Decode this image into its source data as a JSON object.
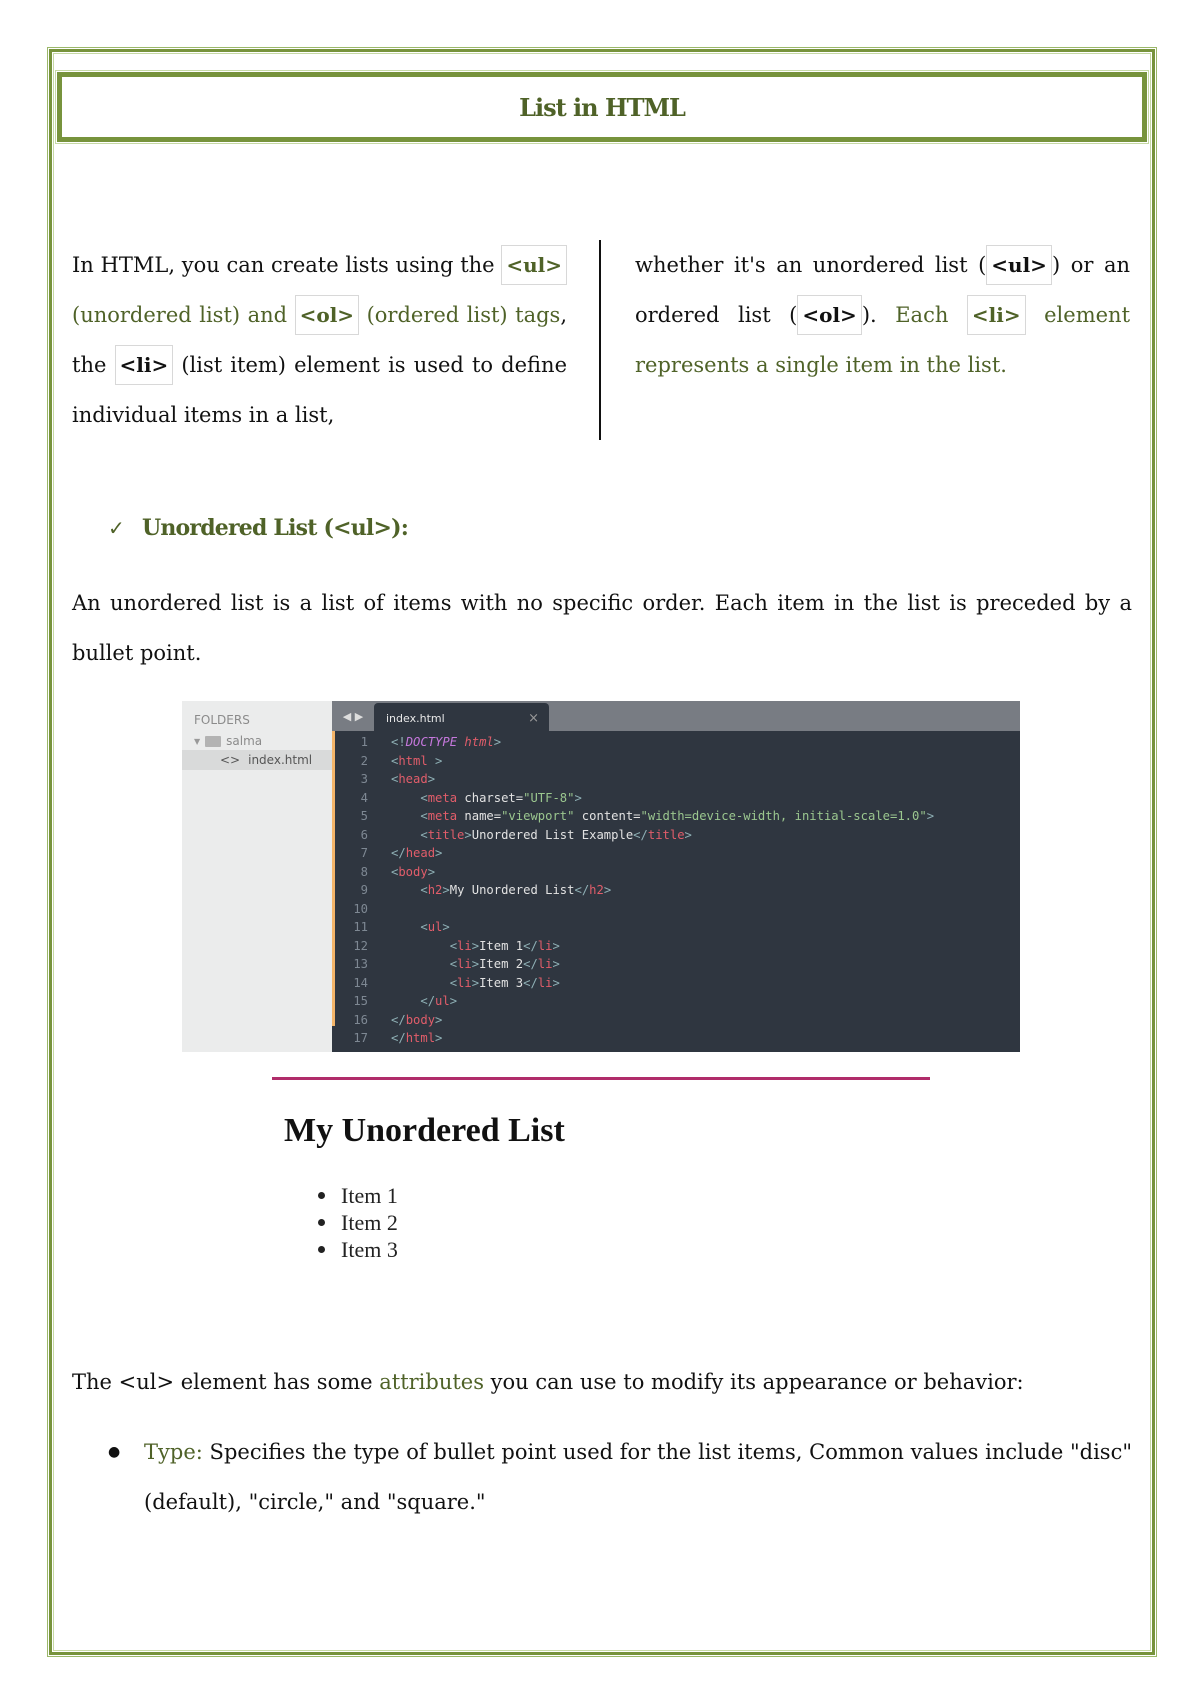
{
  "title": "List in HTML",
  "intro": {
    "left": {
      "t1": "In HTML, you can create lists using the ",
      "tag_ul": "<ul>",
      "t2": " (unordered list) and ",
      "tag_ol": "<ol>",
      "t3": " (ordered list) tags",
      "t4": ", the ",
      "tag_li": "<li>",
      "t5": " (list item) element is used to define individual items in a list,"
    },
    "right": {
      "t1": "whether it's an unordered list (",
      "tag_ul": "<ul>",
      "t2": ") or an ordered list (",
      "tag_ol": "<ol>",
      "t3": "). ",
      "t4": "Each ",
      "tag_li": "<li>",
      "t5": " element represents a single item in the list."
    }
  },
  "section": {
    "check_icon": "✓",
    "heading": "Unordered List (<ul>):",
    "description": "An unordered list is a list of items with no specific order. Each item in the list is preceded by a bullet point."
  },
  "editor": {
    "sidebar_title": "FOLDERS",
    "folder_name": "salma",
    "file_name": "index.html",
    "tab_name": "index.html",
    "tab_close": "×",
    "nav_arrows": "◀ ▶",
    "lines": [
      {
        "n": "1"
      },
      {
        "n": "2"
      },
      {
        "n": "3"
      },
      {
        "n": "4"
      },
      {
        "n": "5"
      },
      {
        "n": "6"
      },
      {
        "n": "7"
      },
      {
        "n": "8"
      },
      {
        "n": "9"
      },
      {
        "n": "10"
      },
      {
        "n": "11"
      },
      {
        "n": "12"
      },
      {
        "n": "13"
      },
      {
        "n": "14"
      },
      {
        "n": "15"
      },
      {
        "n": "16"
      },
      {
        "n": "17"
      }
    ],
    "code": {
      "l1_a": "<!",
      "l1_b": "DOCTYPE",
      "l1_c": " html",
      "l1_d": ">",
      "l2_tag": "html",
      "l3_tag": "head",
      "l4_tag": "meta",
      "l4_attr": " charset",
      "l4_val": "\"UTF-8\"",
      "l5_tag": "meta",
      "l5_attr1": " name",
      "l5_val1": "\"viewport\"",
      "l5_attr2": " content",
      "l5_val2": "\"width=device-width, initial-scale=1.0\"",
      "l6_tag": "title",
      "l6_text": "Unordered List Example",
      "l7_tag": "head",
      "l8_tag": "body",
      "l9_tag": "h2",
      "l9_text": "My Unordered List",
      "l11_tag": "ul",
      "li_tag": "li",
      "l12_text": "Item 1",
      "l13_text": "Item 2",
      "l14_text": "Item 3",
      "l15_tag": "ul",
      "l16_tag": "body",
      "l17_tag": "html"
    }
  },
  "rendered": {
    "heading": "My Unordered List",
    "items": [
      "Item 1",
      "Item 2",
      "Item 3"
    ]
  },
  "attributes": {
    "intro_a": "The <ul> element has some ",
    "intro_b": "attributes",
    "intro_c": " you can use to modify its appearance or behavior:",
    "items": [
      {
        "name": "Type:",
        "text": " Specifies the type of bullet point used for the list items, Common values include \"disc\" (default), \"circle,\" and \"square.\""
      }
    ]
  },
  "colors": {
    "accent_green": "#4f6228",
    "border_green": "#77933c",
    "rule_magenta": "#b02c6a"
  }
}
